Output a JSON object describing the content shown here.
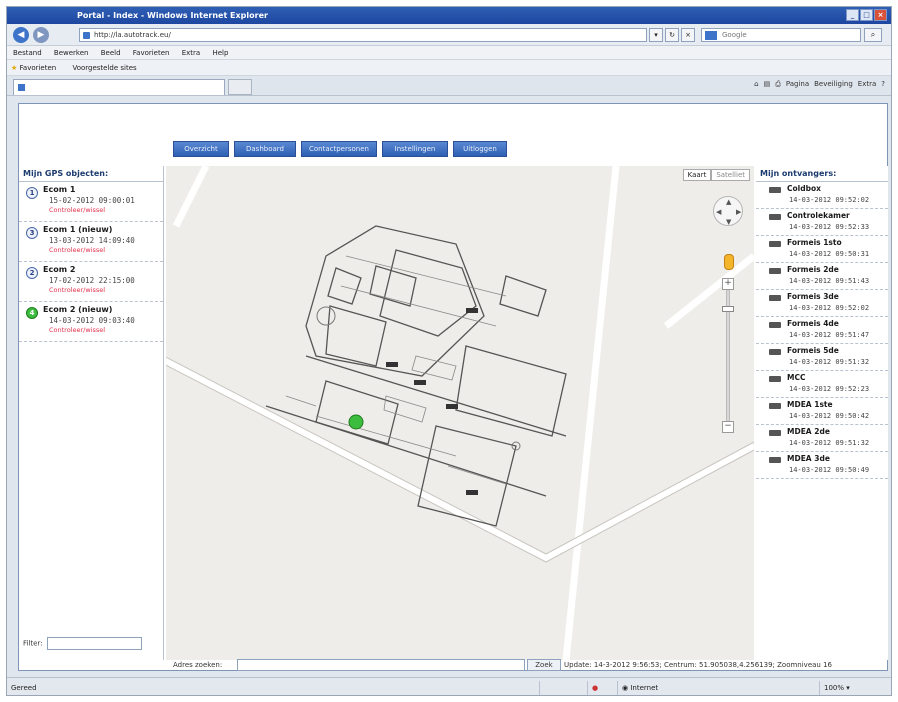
{
  "browser": {
    "title": "Portal - Index - Windows Internet Explorer",
    "address": "http://la.autotrack.eu/",
    "search_placeholder": "Google",
    "menu": [
      "Bestand",
      "Bewerken",
      "Beeld",
      "Favorieten",
      "Extra",
      "Help"
    ],
    "favorites_label": "Favorieten",
    "favorites_link": "Voorgestelde sites",
    "cmdbar": [
      "Pagina",
      "Beveiliging",
      "Extra"
    ],
    "status_left": "Gereed",
    "status_zone": "Internet",
    "status_zoom": "100%"
  },
  "app": {
    "nav": [
      {
        "label": "Overzicht",
        "width": 56
      },
      {
        "label": "Dashboard",
        "width": 62
      },
      {
        "label": "Contactpersonen",
        "width": 76
      },
      {
        "label": "Instellingen",
        "width": 66
      },
      {
        "label": "Uitloggen",
        "width": 54
      }
    ],
    "left": {
      "title": "Mijn GPS objecten:",
      "filter_label": "Filter:",
      "objects": [
        {
          "num": "1",
          "name": "Ecom 1",
          "date": "15-02-2012 09:00:01",
          "status": "Controleer/wissel",
          "active": false
        },
        {
          "num": "3",
          "name": "Ecom 1 (nieuw)",
          "date": "13-03-2012 14:09:40",
          "status": "Controleer/wissel",
          "active": false
        },
        {
          "num": "2",
          "name": "Ecom 2",
          "date": "17-02-2012 22:15:00",
          "status": "Controleer/wissel",
          "active": false
        },
        {
          "num": "4",
          "name": "Ecom 2 (nieuw)",
          "date": "14-03-2012 09:03:40",
          "status": "Controleer/wissel",
          "active": true
        }
      ]
    },
    "map": {
      "type_map": "Kaart",
      "type_sat": "Satelliet"
    },
    "right": {
      "title": "Mijn ontvangers:",
      "receivers": [
        {
          "name": "Coldbox",
          "date": "14-03-2012 09:52:02"
        },
        {
          "name": "Controlekamer",
          "date": "14-03-2012 09:52:33"
        },
        {
          "name": "Formeis 1sto",
          "date": "14-03-2012 09:50:31"
        },
        {
          "name": "Formeis 2de",
          "date": "14-03-2012 09:51:43"
        },
        {
          "name": "Formeis 3de",
          "date": "14-03-2012 09:52:02"
        },
        {
          "name": "Formeis 4de",
          "date": "14-03-2012 09:51:47"
        },
        {
          "name": "Formeis 5de",
          "date": "14-03-2012 09:51:32"
        },
        {
          "name": "MCC",
          "date": "14-03-2012 09:52:23"
        },
        {
          "name": "MDEA 1ste",
          "date": "14-03-2012 09:50:42"
        },
        {
          "name": "MDEA 2de",
          "date": "14-03-2012 09:51:32"
        },
        {
          "name": "MDEA 3de",
          "date": "14-03-2012 09:50:49"
        }
      ]
    },
    "footer": {
      "address_label": "Adres zoeken:",
      "search_button": "Zoek",
      "update_text": "Update: 14-3-2012 9:56:53; Centrum: 51.905038,4.256139; Zoomniveau 16"
    }
  }
}
